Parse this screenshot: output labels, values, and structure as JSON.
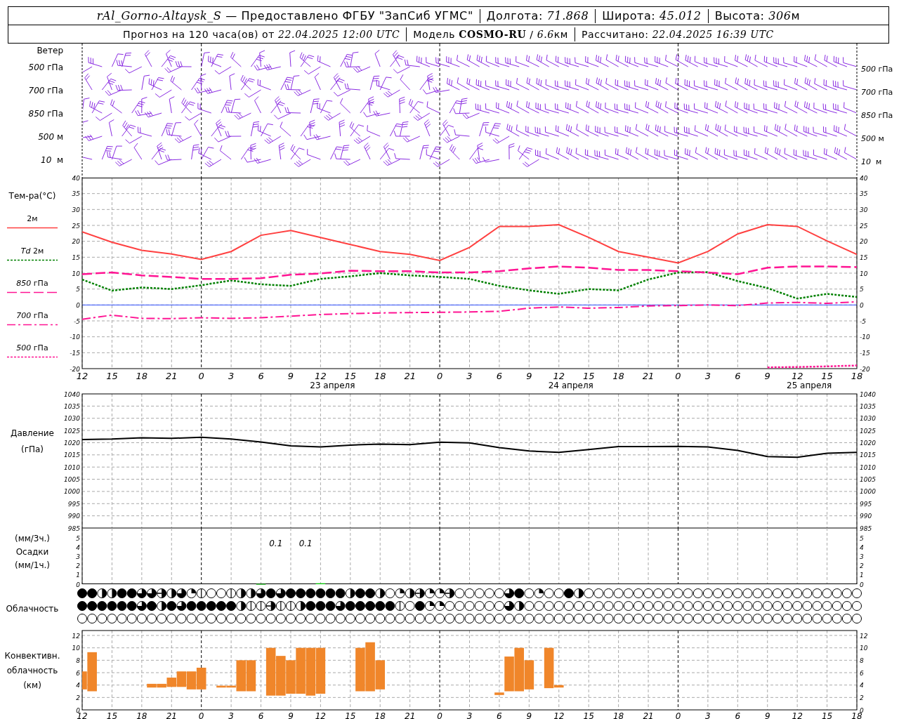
{
  "header": {
    "station": "rAl_Gorno-Altaysk_S",
    "provider": "— Предоставлено ФГБУ \"ЗапСиб УГМС\"",
    "longitude": {
      "label": "Долгота:",
      "value": "71.868"
    },
    "latitude": {
      "label": "Широта:",
      "value": "45.012"
    },
    "elevation": {
      "label": "Высота:",
      "value": "306",
      "unit": "м"
    },
    "forecast": {
      "label": "Прогноз на 120 часа(ов) от",
      "value": "22.04.2025 12:00 UTC"
    },
    "model": {
      "label": "Модель",
      "name": "COSMO-RU",
      "separator": "/",
      "resolution": "6.6",
      "unit": "км"
    },
    "computed": {
      "label": "Рассчитано:",
      "value": "22.04.2025 16:39 UTC"
    }
  },
  "wind": {
    "title": "Ветер",
    "left_labels": [
      "*500* гПа",
      "*700* гПа",
      "*850* гПа",
      "*500* м",
      "*10*  м"
    ],
    "right_labels": [
      "*500* гПа",
      "*700* гПа",
      "*850* гПа",
      "*500* м",
      "*10*  м"
    ]
  },
  "temperature": {
    "title": "Тем-ра(°C)",
    "day_labels": [
      "23 апреля",
      "24 апреля",
      "25 апреля"
    ],
    "right_ticks": [
      "40",
      "35",
      "30",
      "25",
      "20",
      "15",
      "10",
      "5",
      "0",
      "-5",
      "-10",
      "-15",
      "-20"
    ],
    "chart_data": {
      "type": "line",
      "categories": [
        "12",
        "15",
        "18",
        "21",
        "0",
        "3",
        "6",
        "9",
        "12",
        "15",
        "18",
        "21",
        "0",
        "3",
        "6",
        "9",
        "12",
        "15",
        "18",
        "21",
        "0",
        "3",
        "6",
        "9",
        "12",
        "15",
        "18"
      ],
      "ylim": [
        -20,
        40
      ],
      "series": [
        {
          "name": "2м",
          "color": "#ff4040",
          "line_style": "solid",
          "values": [
            23,
            19.7,
            17.2,
            16,
            14.3,
            16.8,
            21.9,
            23.4,
            21.2,
            19,
            16.8,
            15.9,
            14,
            18.1,
            24.7,
            24.7,
            25.2,
            21.2,
            16.8,
            15,
            13.2,
            16.8,
            22.3,
            25.2,
            24.7,
            20.1,
            15.9
          ]
        },
        {
          "name": "*Td* 2м",
          "color": "#008000",
          "line_style": "dotted",
          "values": [
            8,
            4.5,
            5.5,
            5,
            6.2,
            7.7,
            6.5,
            6,
            8.2,
            9,
            10,
            9.3,
            8.8,
            8.2,
            6,
            4.6,
            3.5,
            5,
            4.6,
            8,
            10.2,
            10.3,
            7.5,
            5.3,
            2,
            3.5,
            2.5
          ]
        },
        {
          "name": "*850* гПа",
          "color": "#ff1493",
          "line_style": "dashed",
          "values": [
            9.7,
            10.2,
            9.3,
            8.8,
            8.2,
            8.2,
            8.4,
            9.5,
            9.9,
            10.8,
            10.6,
            10.6,
            10.2,
            10.2,
            10.6,
            11.5,
            12.1,
            11.7,
            11,
            11,
            10.6,
            10.2,
            9.7,
            11.7,
            12.1,
            12.1,
            11.9
          ]
        },
        {
          "name": "*700* гПа",
          "color": "#ff1493",
          "line_style": "dashdot",
          "values": [
            -4.5,
            -3.2,
            -4.2,
            -4.3,
            -4,
            -4.2,
            -4,
            -3.5,
            -3,
            -2.7,
            -2.5,
            -2.4,
            -2.3,
            -2.2,
            -2,
            -1,
            -0.6,
            -1,
            -0.8,
            -0.3,
            -0.2,
            0,
            -0.2,
            0.6,
            0.8,
            0.5,
            1
          ]
        },
        {
          "name": "*500* гПа",
          "color": "#ff1493",
          "line_style": "dotted",
          "values": [
            null,
            null,
            null,
            null,
            null,
            null,
            null,
            null,
            null,
            null,
            null,
            null,
            null,
            null,
            null,
            null,
            null,
            null,
            null,
            null,
            null,
            null,
            null,
            -19.6,
            -19.5,
            -19.3,
            -19
          ]
        }
      ],
      "yticks": [
        40,
        35,
        30,
        25,
        20,
        15,
        10,
        5,
        0,
        -5,
        -10,
        -15,
        -20
      ],
      "grid": true,
      "ref_lines": [
        {
          "axis": "y",
          "value": 0,
          "color": "#3050ff"
        }
      ]
    }
  },
  "pressure": {
    "title": "Давление",
    "unit": "(гПа)",
    "right_ticks": [
      "1040",
      "1035",
      "1030",
      "1025",
      "1020",
      "1015",
      "1010",
      "1005",
      "1000",
      "995",
      "990",
      "985"
    ],
    "chart_data": {
      "type": "line",
      "categories": [
        null,
        null,
        null,
        null,
        null,
        null,
        null,
        null,
        null,
        null,
        null,
        null,
        null,
        null,
        null,
        null,
        null,
        null,
        null,
        null,
        null,
        null,
        null,
        null,
        null,
        null,
        null
      ],
      "ylim": [
        985,
        1040
      ],
      "series": [
        {
          "color": "#000000",
          "values": [
            1021.3,
            1021.5,
            1022,
            1021.8,
            1022.2,
            1021.5,
            1020.3,
            1018.7,
            1018.3,
            1019,
            1019.4,
            1019.2,
            1020.2,
            1019.9,
            1018,
            1016.6,
            1016,
            1017.2,
            1018.4,
            1018.4,
            1018.5,
            1018.3,
            1016.8,
            1014.3,
            1014,
            1015.7,
            1016
          ]
        }
      ],
      "yticks": [
        1040,
        1035,
        1030,
        1025,
        1020,
        1015,
        1010,
        1005,
        1000,
        995,
        990,
        985
      ],
      "grid": true
    }
  },
  "precipitation": {
    "unit_top": "(мм/3ч.)",
    "title": "Осадки",
    "unit_bottom": "(мм/1ч.)",
    "right_ticks": [
      "5",
      "4",
      "3",
      "2",
      "1",
      "0"
    ],
    "chart_data": {
      "type": "bar",
      "categories": [
        null,
        null,
        null,
        null,
        null,
        null,
        null,
        null,
        null,
        null,
        null,
        null,
        null,
        null,
        null,
        null,
        null,
        null,
        null,
        null,
        null,
        null,
        null,
        null,
        null,
        null,
        null,
        null,
        null,
        null,
        null,
        null,
        null,
        null,
        null,
        null,
        null,
        null,
        null,
        null,
        null,
        null,
        null,
        null,
        null,
        null,
        null,
        null,
        null,
        null,
        null,
        null,
        null,
        null,
        null,
        null,
        null,
        null,
        null,
        null,
        null,
        null,
        null,
        null,
        null,
        null,
        null,
        null,
        null,
        null,
        null,
        null,
        null,
        null,
        null,
        null,
        null,
        null,
        null
      ],
      "values": [
        0,
        0,
        0,
        0,
        0,
        0,
        0,
        0,
        0,
        0,
        0,
        0,
        0,
        0,
        0,
        0,
        0,
        0,
        0.03,
        0,
        0,
        0,
        0,
        0,
        0.1,
        0,
        0,
        0,
        0,
        0,
        0,
        0,
        0,
        0,
        0,
        0,
        0,
        0,
        0,
        0,
        0,
        0,
        0,
        0,
        0,
        0,
        0,
        0,
        0,
        0,
        0,
        0,
        0,
        0,
        0,
        0,
        0,
        0,
        0,
        0,
        0,
        0,
        0,
        0,
        0,
        0,
        0,
        0,
        0,
        0,
        0,
        0,
        0,
        0,
        0,
        0,
        0,
        0,
        0
      ],
      "ylim": [
        0,
        6.15
      ],
      "yticks": [
        5,
        4,
        3,
        2,
        1,
        0
      ],
      "grid": true,
      "annotations": [
        "0.1",
        "0.1"
      ]
    }
  },
  "cloudiness": {
    "title": "Облачность",
    "rows": [
      {
        "cells": [
          {
            "kind": "full"
          },
          {
            "kind": "full"
          },
          {
            "kind": "half"
          },
          {
            "kind": "half"
          },
          {
            "kind": "full"
          },
          {
            "kind": "full"
          },
          {
            "kind": "three"
          },
          {
            "kind": "three"
          },
          {
            "kind": "halfline"
          },
          {
            "kind": "half"
          },
          {
            "kind": "three"
          },
          {
            "kind": "quarter"
          },
          {
            "kind": "line"
          },
          {
            "kind": "empty"
          },
          {
            "kind": "empty"
          },
          {
            "kind": "line"
          },
          {
            "kind": "half"
          },
          {
            "kind": "half"
          },
          {
            "kind": "three"
          },
          {
            "kind": "full"
          },
          {
            "kind": "three"
          },
          {
            "kind": "full"
          },
          {
            "kind": "full"
          },
          {
            "kind": "full"
          },
          {
            "kind": "full"
          },
          {
            "kind": "full"
          },
          {
            "kind": "full"
          },
          {
            "kind": "half"
          },
          {
            "kind": "full"
          },
          {
            "kind": "full"
          },
          {
            "kind": "half"
          },
          {
            "kind": "empty"
          },
          {
            "kind": "quarter"
          },
          {
            "kind": "half"
          },
          {
            "kind": "halfline"
          },
          {
            "kind": "quarter"
          },
          {
            "kind": "quarter"
          },
          {
            "kind": "halfline"
          },
          {
            "kind": "empty"
          },
          {
            "kind": "empty"
          },
          {
            "kind": "empty"
          },
          {
            "kind": "empty"
          },
          {
            "kind": "empty"
          },
          {
            "kind": "three"
          },
          {
            "kind": "full"
          },
          {
            "kind": "empty"
          },
          {
            "kind": "quarter"
          },
          {
            "kind": "empty"
          },
          {
            "kind": "empty"
          },
          {
            "kind": "full"
          },
          {
            "kind": "half"
          },
          {
            "kind": "empty"
          },
          {
            "kind": "empty"
          },
          {
            "kind": "empty"
          },
          {
            "kind": "empty"
          },
          {
            "kind": "empty"
          },
          {
            "kind": "empty"
          },
          {
            "kind": "empty"
          },
          {
            "kind": "empty"
          },
          {
            "kind": "empty"
          },
          {
            "kind": "empty"
          },
          {
            "kind": "empty"
          },
          {
            "kind": "empty"
          },
          {
            "kind": "empty"
          },
          {
            "kind": "empty"
          },
          {
            "kind": "empty"
          },
          {
            "kind": "empty"
          },
          {
            "kind": "empty"
          },
          {
            "kind": "empty"
          },
          {
            "kind": "empty"
          },
          {
            "kind": "empty"
          },
          {
            "kind": "empty"
          },
          {
            "kind": "empty"
          },
          {
            "kind": "empty"
          },
          {
            "kind": "empty"
          },
          {
            "kind": "empty"
          },
          {
            "kind": "empty"
          },
          {
            "kind": "empty"
          },
          {
            "kind": "empty"
          }
        ]
      },
      {
        "cells": [
          {
            "kind": "full"
          },
          {
            "kind": "full"
          },
          {
            "kind": "full"
          },
          {
            "kind": "full"
          },
          {
            "kind": "full"
          },
          {
            "kind": "full"
          },
          {
            "kind": "three"
          },
          {
            "kind": "full"
          },
          {
            "kind": "half"
          },
          {
            "kind": "full"
          },
          {
            "kind": "three"
          },
          {
            "kind": "full"
          },
          {
            "kind": "full"
          },
          {
            "kind": "full"
          },
          {
            "kind": "full"
          },
          {
            "kind": "full"
          },
          {
            "kind": "half"
          },
          {
            "kind": "line"
          },
          {
            "kind": "line"
          },
          {
            "kind": "halfline"
          },
          {
            "kind": "line"
          },
          {
            "kind": "line"
          },
          {
            "kind": "half"
          },
          {
            "kind": "full"
          },
          {
            "kind": "full"
          },
          {
            "kind": "full"
          },
          {
            "kind": "three"
          },
          {
            "kind": "full"
          },
          {
            "kind": "full"
          },
          {
            "kind": "full"
          },
          {
            "kind": "full"
          },
          {
            "kind": "full"
          },
          {
            "kind": "line"
          },
          {
            "kind": "empty"
          },
          {
            "kind": "full"
          },
          {
            "kind": "quarter"
          },
          {
            "kind": "quarter"
          },
          {
            "kind": "empty"
          },
          {
            "kind": "empty"
          },
          {
            "kind": "empty"
          },
          {
            "kind": "empty"
          },
          {
            "kind": "empty"
          },
          {
            "kind": "empty"
          },
          {
            "kind": "three"
          },
          {
            "kind": "half"
          },
          {
            "kind": "empty"
          },
          {
            "kind": "empty"
          },
          {
            "kind": "empty"
          },
          {
            "kind": "empty"
          },
          {
            "kind": "empty"
          },
          {
            "kind": "empty"
          },
          {
            "kind": "empty"
          },
          {
            "kind": "empty"
          },
          {
            "kind": "empty"
          },
          {
            "kind": "empty"
          },
          {
            "kind": "empty"
          },
          {
            "kind": "empty"
          },
          {
            "kind": "empty"
          },
          {
            "kind": "empty"
          },
          {
            "kind": "empty"
          },
          {
            "kind": "empty"
          },
          {
            "kind": "empty"
          },
          {
            "kind": "empty"
          },
          {
            "kind": "empty"
          },
          {
            "kind": "empty"
          },
          {
            "kind": "empty"
          },
          {
            "kind": "empty"
          },
          {
            "kind": "empty"
          },
          {
            "kind": "empty"
          },
          {
            "kind": "empty"
          },
          {
            "kind": "empty"
          },
          {
            "kind": "empty"
          },
          {
            "kind": "empty"
          },
          {
            "kind": "empty"
          },
          {
            "kind": "empty"
          },
          {
            "kind": "empty"
          },
          {
            "kind": "empty"
          },
          {
            "kind": "empty"
          },
          {
            "kind": "empty"
          }
        ]
      },
      {
        "cells": [
          {
            "kind": "empty"
          },
          {
            "kind": "empty"
          },
          {
            "kind": "empty"
          },
          {
            "kind": "empty"
          },
          {
            "kind": "empty"
          },
          {
            "kind": "empty"
          },
          {
            "kind": "empty"
          },
          {
            "kind": "empty"
          },
          {
            "kind": "empty"
          },
          {
            "kind": "empty"
          },
          {
            "kind": "empty"
          },
          {
            "kind": "empty"
          },
          {
            "kind": "empty"
          },
          {
            "kind": "empty"
          },
          {
            "kind": "empty"
          },
          {
            "kind": "empty"
          },
          {
            "kind": "empty"
          },
          {
            "kind": "empty"
          },
          {
            "kind": "empty"
          },
          {
            "kind": "empty"
          },
          {
            "kind": "empty"
          },
          {
            "kind": "empty"
          },
          {
            "kind": "empty"
          },
          {
            "kind": "empty"
          },
          {
            "kind": "empty"
          },
          {
            "kind": "empty"
          },
          {
            "kind": "empty"
          },
          {
            "kind": "empty"
          },
          {
            "kind": "empty"
          },
          {
            "kind": "empty"
          },
          {
            "kind": "empty"
          },
          {
            "kind": "empty"
          },
          {
            "kind": "empty"
          },
          {
            "kind": "empty"
          },
          {
            "kind": "empty"
          },
          {
            "kind": "empty"
          },
          {
            "kind": "empty"
          },
          {
            "kind": "empty"
          },
          {
            "kind": "empty"
          },
          {
            "kind": "empty"
          },
          {
            "kind": "empty"
          },
          {
            "kind": "empty"
          },
          {
            "kind": "empty"
          },
          {
            "kind": "empty"
          },
          {
            "kind": "empty"
          },
          {
            "kind": "empty"
          },
          {
            "kind": "empty"
          },
          {
            "kind": "empty"
          },
          {
            "kind": "empty"
          },
          {
            "kind": "empty"
          },
          {
            "kind": "empty"
          },
          {
            "kind": "empty"
          },
          {
            "kind": "empty"
          },
          {
            "kind": "empty"
          },
          {
            "kind": "empty"
          },
          {
            "kind": "empty"
          },
          {
            "kind": "empty"
          },
          {
            "kind": "empty"
          },
          {
            "kind": "empty"
          },
          {
            "kind": "empty"
          },
          {
            "kind": "empty"
          },
          {
            "kind": "empty"
          },
          {
            "kind": "empty"
          },
          {
            "kind": "empty"
          },
          {
            "kind": "empty"
          },
          {
            "kind": "empty"
          },
          {
            "kind": "empty"
          },
          {
            "kind": "empty"
          },
          {
            "kind": "empty"
          },
          {
            "kind": "empty"
          },
          {
            "kind": "empty"
          },
          {
            "kind": "empty"
          },
          {
            "kind": "empty"
          },
          {
            "kind": "empty"
          },
          {
            "kind": "empty"
          },
          {
            "kind": "empty"
          },
          {
            "kind": "empty"
          },
          {
            "kind": "empty"
          },
          {
            "kind": "empty"
          }
        ]
      }
    ]
  },
  "convective": {
    "title_lines": [
      "Конвективн.",
      "облачность",
      "(км)"
    ],
    "right_ticks": [
      "12",
      "10",
      "8",
      "6",
      "4",
      "2",
      "0"
    ],
    "chart_data": {
      "type": "candlestick",
      "categories": [
        "12",
        null,
        null,
        "15",
        null,
        null,
        "18",
        null,
        null,
        "21",
        null,
        null,
        "0",
        null,
        null,
        "3",
        null,
        null,
        "6",
        null,
        null,
        "9",
        null,
        null,
        "12",
        null,
        null,
        "15",
        null,
        null,
        "18",
        null,
        null,
        "21",
        null,
        null,
        "0",
        null,
        null,
        "3",
        null,
        null,
        "6",
        null,
        null,
        "9",
        null,
        null,
        "12",
        null,
        null,
        "15",
        null,
        null,
        "18",
        null,
        null,
        "21",
        null,
        null,
        "0",
        null,
        null,
        "3",
        null,
        null,
        "6",
        null,
        null,
        "9",
        null,
        null,
        "12",
        null,
        null,
        "15",
        null,
        null,
        "18"
      ],
      "ylim": [
        0,
        12
      ],
      "color": "#f0862a",
      "ohlc": [
        [
          3.3,
          6.2,
          3.3,
          6.2
        ],
        [
          3,
          9.3,
          3,
          9.3
        ],
        null,
        null,
        null,
        null,
        null,
        [
          3.6,
          4.2,
          3.6,
          4.2
        ],
        [
          3.6,
          4.2,
          3.6,
          4.2
        ],
        [
          3.7,
          5.2,
          3.7,
          5.2
        ],
        [
          3.7,
          6.2,
          3.7,
          6.2
        ],
        [
          3.3,
          6.2,
          3.3,
          6.2
        ],
        [
          3.3,
          6.8,
          3.3,
          6.8
        ],
        null,
        [
          3.6,
          3.9,
          3.6,
          3.9
        ],
        [
          3.6,
          3.9,
          3.6,
          3.9
        ],
        [
          3,
          8,
          3,
          8
        ],
        [
          3,
          8,
          3,
          8
        ],
        null,
        [
          2.3,
          10,
          2.3,
          10
        ],
        [
          2.3,
          8.7,
          2.3,
          8.7
        ],
        [
          2.6,
          8,
          2.6,
          8
        ],
        [
          2.6,
          10,
          2.6,
          10
        ],
        [
          2.3,
          10,
          2.3,
          10
        ],
        [
          2.6,
          10,
          2.6,
          10
        ],
        null,
        null,
        null,
        [
          3,
          10,
          3,
          10
        ],
        [
          3,
          10.9,
          3,
          10.9
        ],
        [
          3.3,
          8,
          3.3,
          8
        ],
        null,
        null,
        null,
        null,
        null,
        null,
        null,
        null,
        null,
        null,
        null,
        [
          2.4,
          2.8,
          2.4,
          2.8
        ],
        [
          3,
          8.6,
          3,
          8.6
        ],
        [
          3,
          10,
          3,
          10
        ],
        [
          3.3,
          8,
          3.3,
          8
        ],
        null,
        [
          3.5,
          10,
          3.5,
          10
        ],
        [
          3.6,
          4,
          3.6,
          4
        ],
        null,
        null,
        null,
        null,
        null,
        null,
        null,
        null,
        null,
        null,
        null,
        null,
        null,
        null,
        null,
        null,
        null,
        null,
        null,
        null,
        null,
        null,
        null,
        null,
        null,
        null,
        null,
        null,
        null,
        null
      ],
      "yticks": [
        12,
        10,
        8,
        6,
        4,
        2,
        0
      ],
      "grid": true
    }
  }
}
